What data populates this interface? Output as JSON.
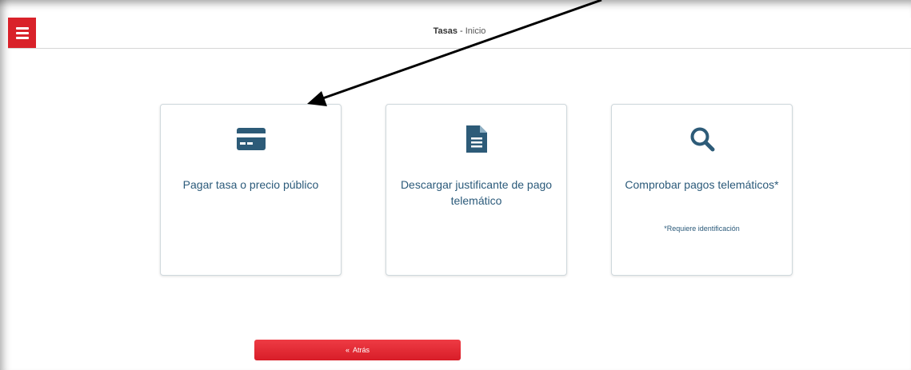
{
  "header": {
    "title": "Tasas",
    "separator": " - ",
    "subtitle": "Inicio"
  },
  "menu": {
    "icon": "hamburger-menu-icon"
  },
  "tiles": [
    {
      "icon": "credit-card-icon",
      "label": "Pagar tasa o precio público",
      "note": ""
    },
    {
      "icon": "document-icon",
      "label": "Descargar justificante de pago telemático",
      "note": ""
    },
    {
      "icon": "search-icon",
      "label": "Comprobar pagos telemáticos*",
      "note": "*Requiere identificación"
    }
  ],
  "back_button": {
    "icon": "double-chevron-left-icon",
    "label": "Atrás"
  },
  "colors": {
    "accent_red": "#d9222a",
    "icon_blue": "#2d5b78",
    "text_blue": "#2b5a7a"
  },
  "annotation": {
    "type": "arrow",
    "pointing_to": "Pagar tasa o precio público"
  }
}
